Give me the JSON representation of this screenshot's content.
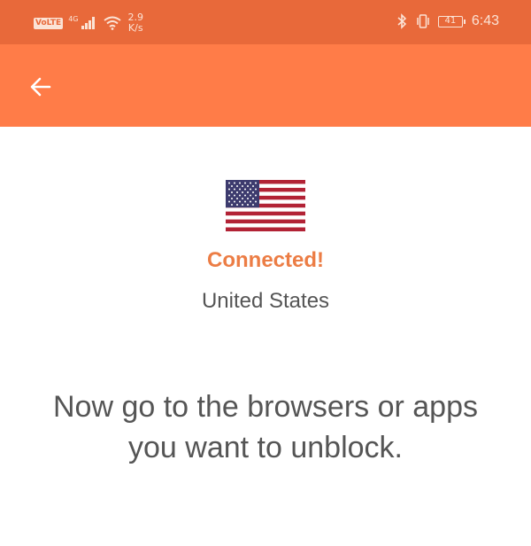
{
  "status_bar": {
    "volte": "VoLTE",
    "network_type": "4G",
    "speed_value": "2.9",
    "speed_unit": "K/s",
    "battery_level": "41",
    "time": "6:43",
    "icons": [
      "volte-icon",
      "signal-icon",
      "wifi-icon",
      "bluetooth-icon",
      "vibrate-icon",
      "battery-icon"
    ]
  },
  "app_bar": {
    "back_icon": "arrow-left-icon"
  },
  "connection": {
    "flag": "us-flag",
    "status": "Connected!",
    "country": "United States"
  },
  "instruction": "Now go to the browsers or apps you want to unblock.",
  "colors": {
    "status_bar": "#e8693a",
    "app_bar": "#ff7c48",
    "accent": "#ec7d45",
    "text": "#555555"
  }
}
